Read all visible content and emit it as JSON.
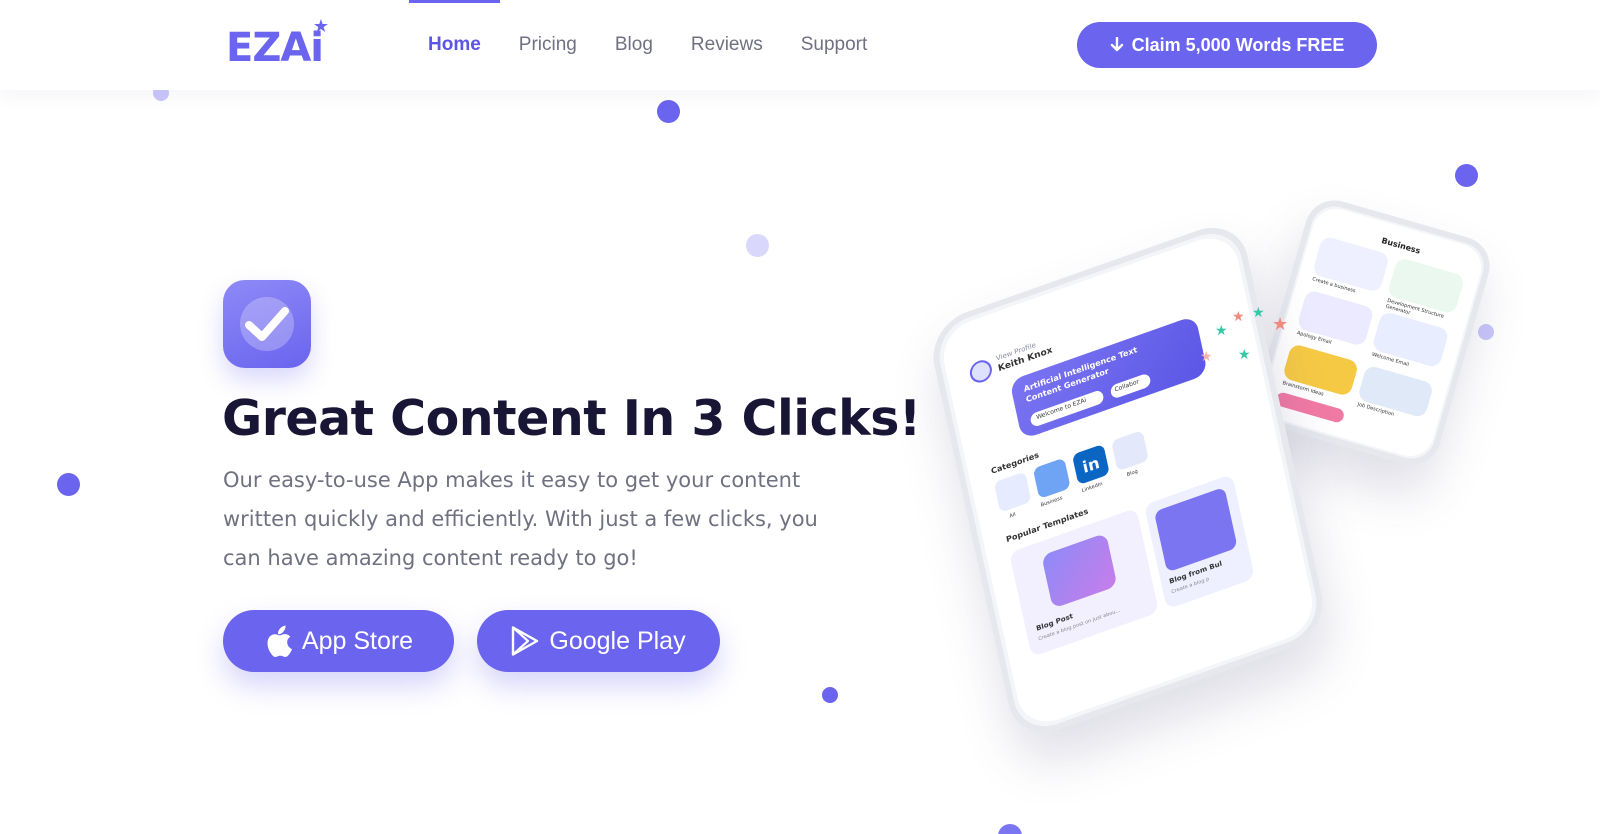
{
  "header": {
    "logo_text": "EZAi",
    "nav": [
      {
        "label": "Home",
        "active": true
      },
      {
        "label": "Pricing",
        "active": false
      },
      {
        "label": "Blog",
        "active": false
      },
      {
        "label": "Reviews",
        "active": false
      },
      {
        "label": "Support",
        "active": false
      }
    ],
    "cta_label": "Claim 5,000 Words FREE"
  },
  "hero": {
    "headline": "Great Content In 3 Clicks!",
    "subtext": "Our easy-to-use App makes it easy to get your content written quickly and efficiently. With just a few clicks, you can have amazing content ready to go!",
    "app_store_label": "App Store",
    "google_play_label": "Google Play"
  },
  "phone_main": {
    "view_profile": "View Profile",
    "user_name": "Keith Knox",
    "banner_title": "Artificial Intelligence Text Content Generator",
    "banner_chip_1": "Welcome to EZAi",
    "banner_chip_2": "Collabor",
    "categories_label": "Categories",
    "categories": [
      "All",
      "Business",
      "LinkedIn",
      "Blog"
    ],
    "popular_label": "Popular Templates",
    "templates": [
      {
        "title": "Blog Post",
        "desc": "Create a blog post on just abou..."
      },
      {
        "title": "Blog from Bul",
        "desc": "Create a blog p"
      }
    ]
  },
  "phone_back": {
    "title": "Business",
    "items": [
      "Create a business",
      "Development Structure Generator",
      "Apology Email",
      "Welcome Email",
      "Brainstorm Ideas",
      "Job Description"
    ]
  },
  "colors": {
    "accent": "#6a64ee",
    "accent_light": "#c9c6fb",
    "heading": "#181535",
    "body": "#6f7180"
  }
}
